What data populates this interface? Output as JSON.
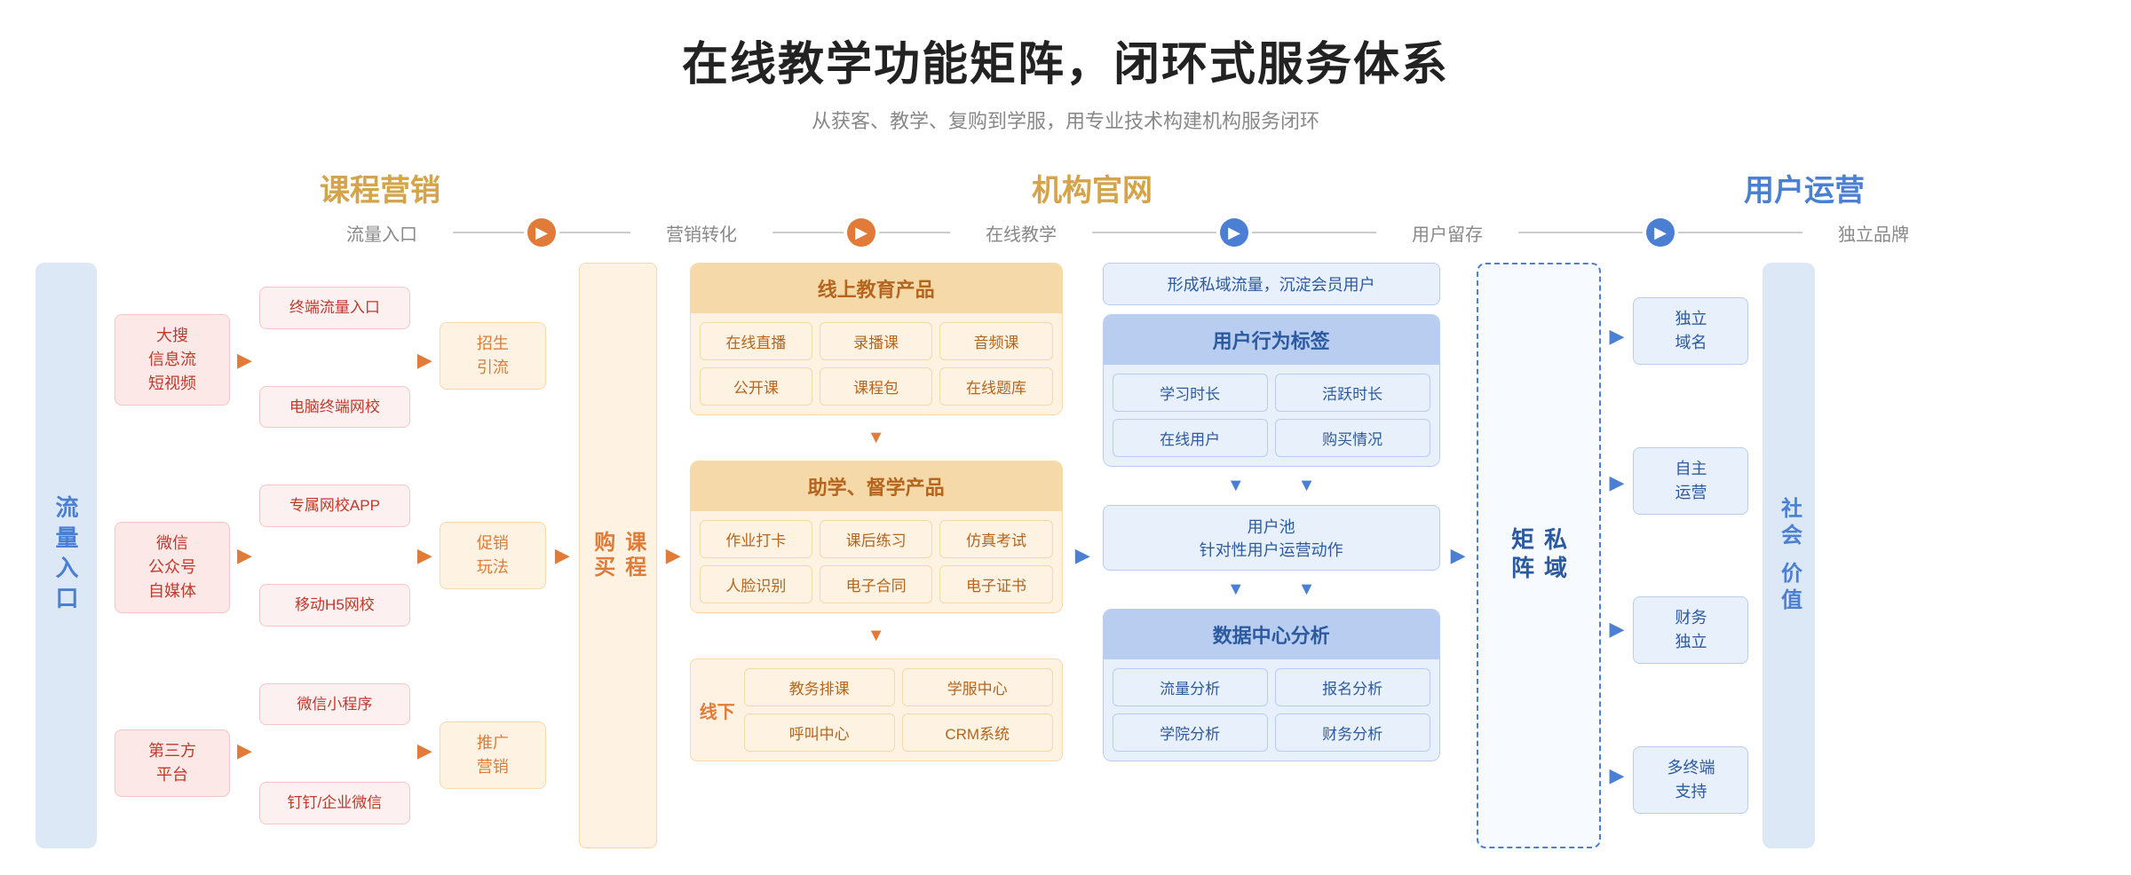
{
  "page": {
    "main_title": "在线教学功能矩阵，闭环式服务体系",
    "sub_title": "从获客、教学、复购到学服，用专业技术构建机构服务闭环",
    "category1": "课程营销",
    "category2": "机构官网",
    "category3": "用户运营",
    "flow_labels": [
      "流量入口",
      "营销转化",
      "在线教学",
      "用户留存",
      "独立品牌"
    ],
    "left_entry_label": "流量入口",
    "traffic_sources": [
      {
        "title": "大搜\n信息流\n短视频"
      },
      {
        "title": "微信\n公众号\n自媒体"
      },
      {
        "title": "第三方\n平台"
      }
    ],
    "terminal_items": [
      "终端流量入口",
      "电脑终端网校",
      "专属网校APP",
      "移动H5网校",
      "微信小程序",
      "钉钉/企业微信"
    ],
    "marketing_items": [
      "招生\n引流",
      "促销\n玩法",
      "推广\n营销"
    ],
    "course_purchase_label": "课程\n购买",
    "online_section": {
      "header": "线上教育产品",
      "items": [
        "在线直播",
        "录播课",
        "音频课",
        "公开课",
        "课程包",
        "在线题库"
      ]
    },
    "assist_section": {
      "header": "助学、督学产品",
      "items": [
        "作业打卡",
        "课后练习",
        "仿真考试",
        "人脸识别",
        "电子合同",
        "电子证书"
      ]
    },
    "offline_section": {
      "label": "线下",
      "items": [
        "教务排课",
        "学服中心",
        "呼叫中心",
        "CRM系统"
      ]
    },
    "user_behavior": {
      "header": "用户行为标签",
      "items": [
        "学习时长",
        "活跃时长",
        "在线用户",
        "购买情况"
      ]
    },
    "user_pool": "用户池\n针对性用户运营动作",
    "data_analysis": {
      "header": "数据中心分析",
      "items": [
        "流量分析",
        "报名分析",
        "学院分析",
        "财务分析"
      ]
    },
    "private_domain": "私域\n矩阵",
    "brand_items": [
      "独立\n域名",
      "自主\n运营",
      "财务\n独立",
      "多终端\n支持"
    ],
    "social_value": "社会\n价值",
    "form_private_domain": "形成私域流量，沉淀会员用户"
  }
}
